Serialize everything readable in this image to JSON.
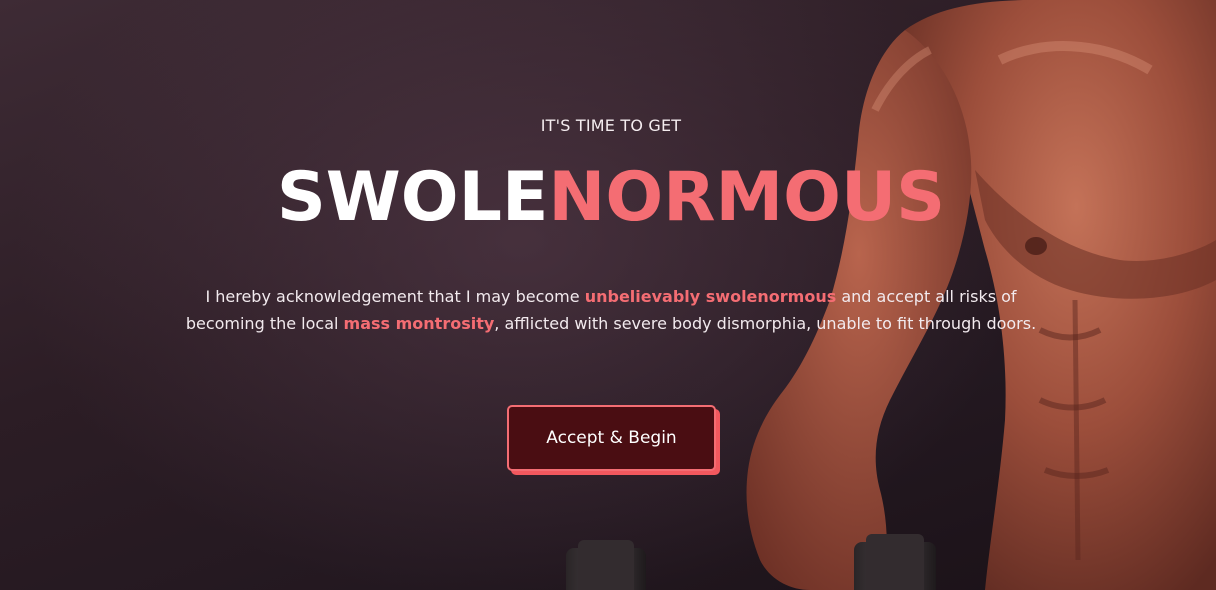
{
  "hero": {
    "eyebrow": "IT'S TIME TO GET",
    "headline_part1": "SWOLE",
    "headline_part2": "NORMOUS",
    "body_seg1": "I hereby acknowledgement that I may become ",
    "body_highlight1": "unbelievably swolenormous",
    "body_seg2": " and accept all risks of becoming the local ",
    "body_highlight2": "mass montrosity",
    "body_seg3": ", afflicted with severe body dismorphia, unable to fit through doors.",
    "cta_label": "Accept & Begin"
  },
  "colors": {
    "accent": "#f46d73",
    "button_bg": "#4a0d12",
    "background": "#2c1d25"
  }
}
